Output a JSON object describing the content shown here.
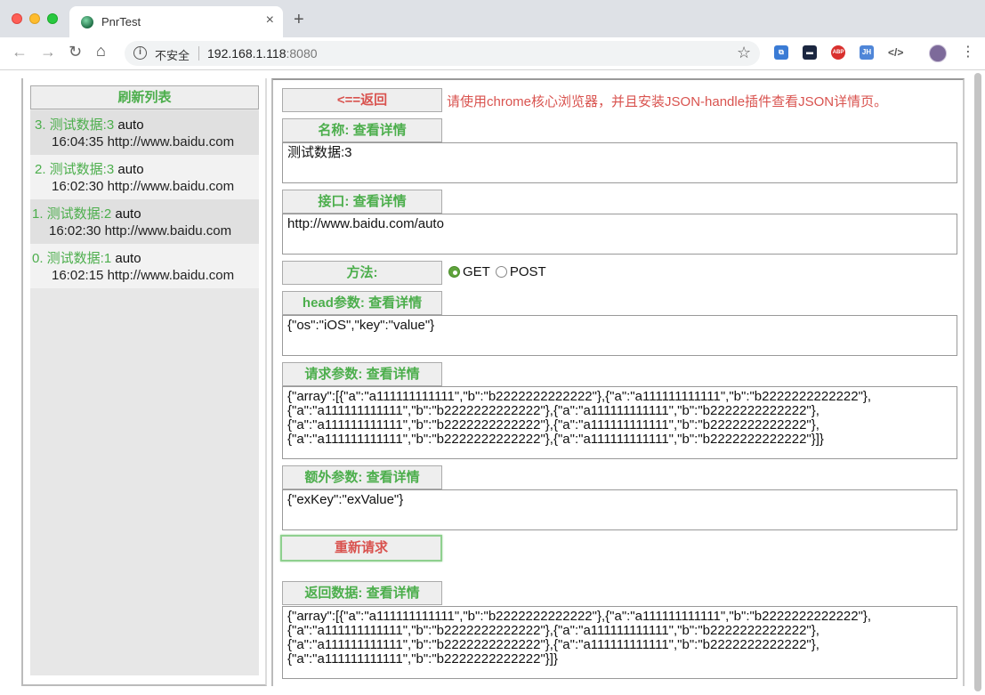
{
  "browser": {
    "tab_title": "PnrTest",
    "tab_close": "×",
    "new_tab": "+",
    "insecure_label": "不安全",
    "url_host": "192.168.1.118",
    "url_port": ":8080",
    "extensions": [
      "ABP",
      "JH",
      "</>"
    ]
  },
  "sidebar": {
    "refresh_label": "刷新列表",
    "items": [
      {
        "title": "3. 测试数据:3",
        "method": "auto",
        "time": "16:04:35",
        "url": "http://www.baidu.com"
      },
      {
        "title": "2. 测试数据:3",
        "method": "auto",
        "time": "16:02:30",
        "url": "http://www.baidu.com"
      },
      {
        "title": "1. 测试数据:2",
        "method": "auto",
        "time": "16:02:30",
        "url": "http://www.baidu.com"
      },
      {
        "title": "0. 测试数据:1",
        "method": "auto",
        "time": "16:02:15",
        "url": "http://www.baidu.com"
      }
    ]
  },
  "main": {
    "back_label": "<==返回",
    "notice": "请使用chrome核心浏览器，并且安装JSON-handle插件查看JSON详情页。",
    "name_label": "名称: 查看详情",
    "name_value": "测试数据:3",
    "api_label": "接口: 查看详情",
    "api_value": "http://www.baidu.com/auto",
    "method_label": "方法:",
    "method_options": [
      "GET",
      "POST"
    ],
    "method_selected": "GET",
    "head_label": "head参数: 查看详情",
    "head_value": "{\"os\":\"iOS\",\"key\":\"value\"}",
    "req_label": "请求参数: 查看详情",
    "req_value": "{\"array\":[{\"a\":\"a111111111111\",\"b\":\"b2222222222222\"},{\"a\":\"a111111111111\",\"b\":\"b2222222222222\"},\n{\"a\":\"a111111111111\",\"b\":\"b2222222222222\"},{\"a\":\"a111111111111\",\"b\":\"b2222222222222\"},\n{\"a\":\"a111111111111\",\"b\":\"b2222222222222\"},{\"a\":\"a111111111111\",\"b\":\"b2222222222222\"},\n{\"a\":\"a111111111111\",\"b\":\"b2222222222222\"},{\"a\":\"a111111111111\",\"b\":\"b2222222222222\"}]}",
    "extra_label": "额外参数: 查看详情",
    "extra_value": "{\"exKey\":\"exValue\"}",
    "resend_label": "重新请求",
    "resp_label": "返回数据: 查看详情",
    "resp_value": "{\"array\":[{\"a\":\"a111111111111\",\"b\":\"b2222222222222\"},{\"a\":\"a111111111111\",\"b\":\"b2222222222222\"},\n{\"a\":\"a111111111111\",\"b\":\"b2222222222222\"},{\"a\":\"a111111111111\",\"b\":\"b2222222222222\"},\n{\"a\":\"a111111111111\",\"b\":\"b2222222222222\"},{\"a\":\"a111111111111\",\"b\":\"b2222222222222\"},\n{\"a\":\"a111111111111\",\"b\":\"b2222222222222\"}]}"
  }
}
